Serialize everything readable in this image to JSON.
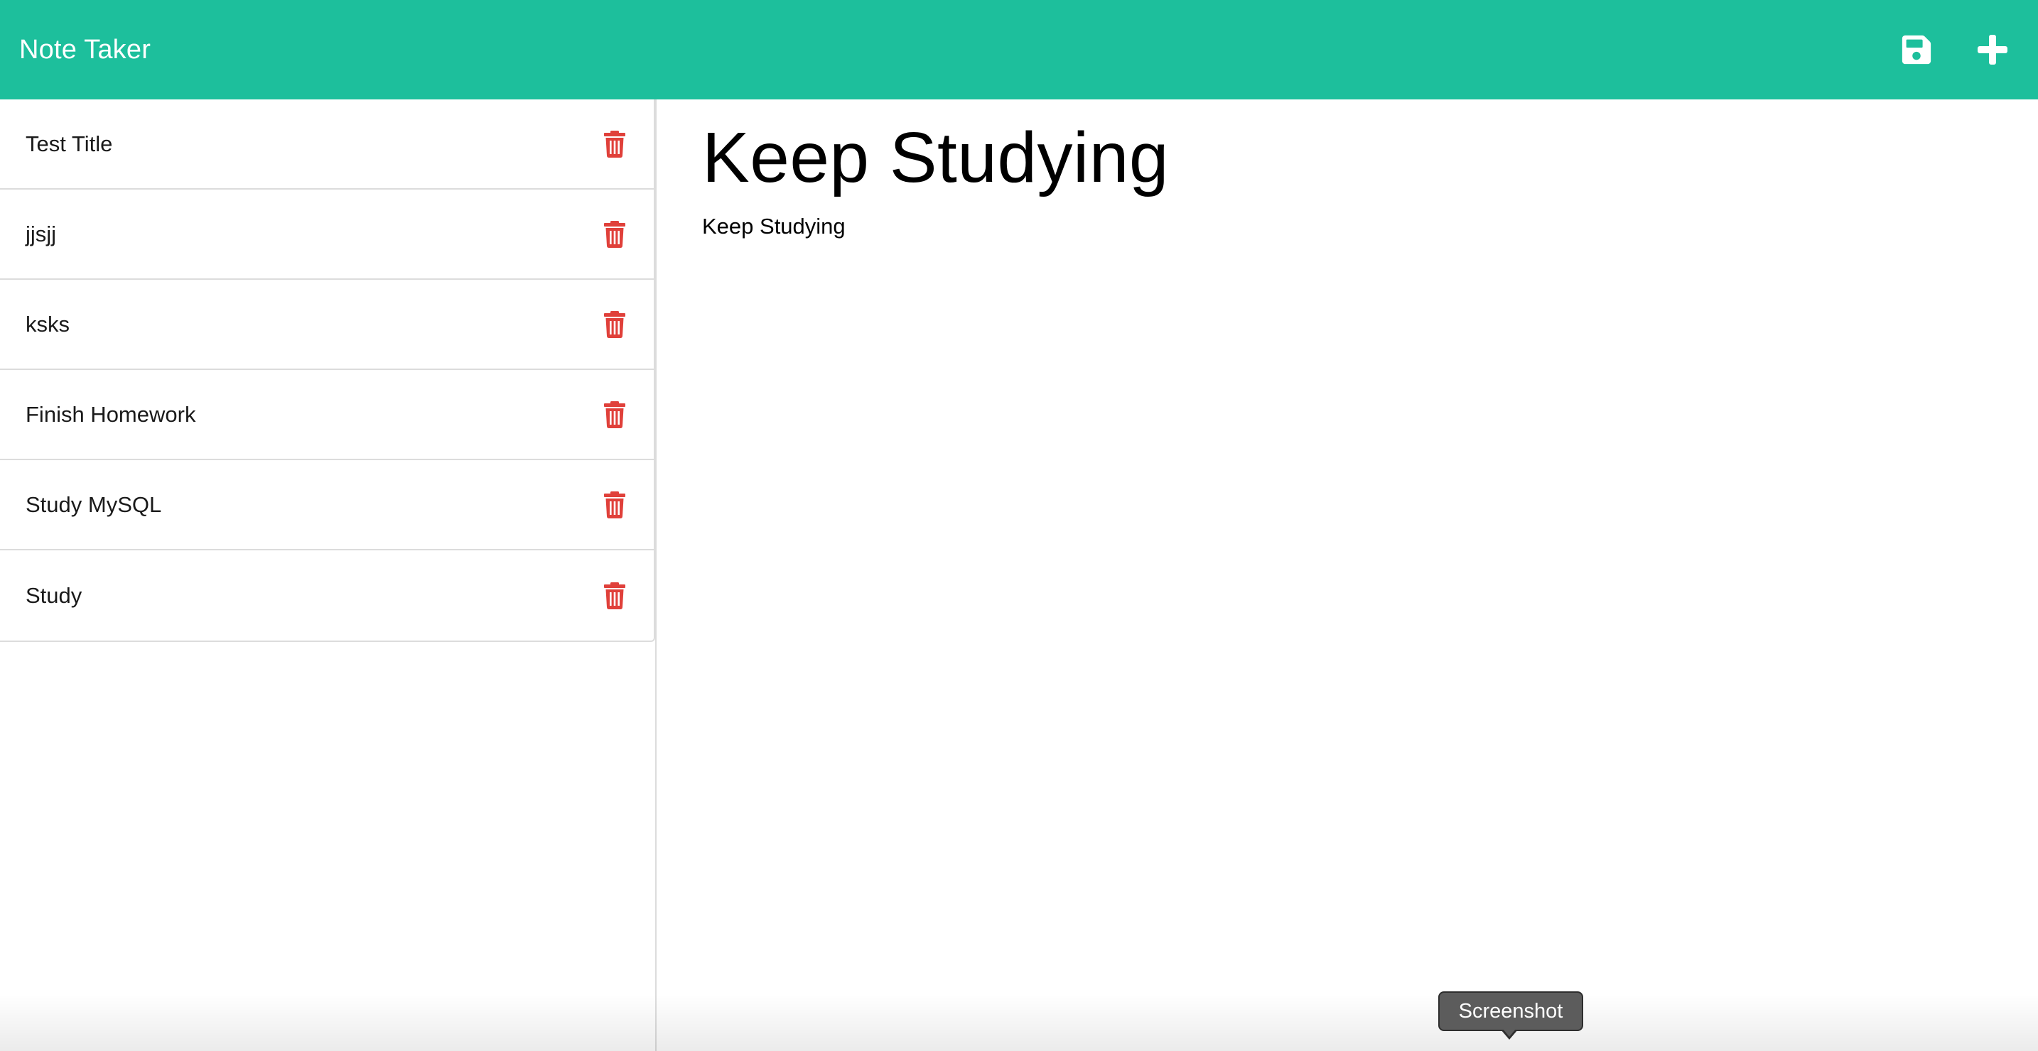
{
  "navbar": {
    "brand": "Note Taker",
    "save_icon": "save-icon",
    "add_icon": "plus-icon",
    "background_color": "#1dbf9c"
  },
  "sidebar": {
    "notes": [
      {
        "title": "Test Title"
      },
      {
        "title": "jjsjj"
      },
      {
        "title": "ksks"
      },
      {
        "title": "Finish Homework"
      },
      {
        "title": "Study MySQL"
      },
      {
        "title": "Study"
      }
    ],
    "delete_icon": "trash-icon",
    "delete_color": "#e0403a"
  },
  "editor": {
    "title": "Keep Studying",
    "body": "Keep Studying"
  },
  "tooltip": {
    "label": "Screenshot"
  }
}
